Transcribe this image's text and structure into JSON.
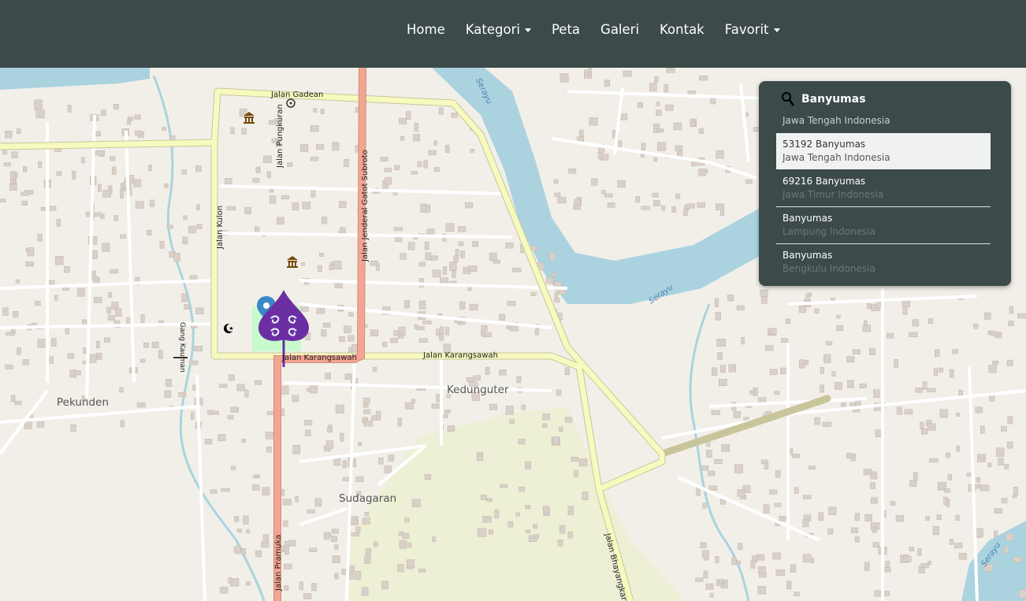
{
  "nav": {
    "items": [
      {
        "label": "Home",
        "dropdown": false
      },
      {
        "label": "Kategori",
        "dropdown": true
      },
      {
        "label": "Peta",
        "dropdown": false
      },
      {
        "label": "Galeri",
        "dropdown": false
      },
      {
        "label": "Kontak",
        "dropdown": false
      },
      {
        "label": "Favorit",
        "dropdown": true
      }
    ]
  },
  "search": {
    "value": "Banyumas",
    "first_result_subtitle": "Jawa Tengah Indonesia",
    "results": [
      {
        "title": "53192 Banyumas",
        "subtitle": "Jawa Tengah Indonesia",
        "active": true
      },
      {
        "title": "69216 Banyumas",
        "subtitle": "Jawa Timur Indonesia",
        "active": false
      },
      {
        "title": "Banyumas",
        "subtitle": "Lampung Indonesia",
        "active": false
      },
      {
        "title": "Banyumas",
        "subtitle": "Bengkulu Indonesia",
        "active": false
      }
    ]
  },
  "map": {
    "labels": {
      "jalan_gadean": "Jalan Gadean",
      "jalan_pungkuran": "Jalan Pungkuran",
      "jalan_gatot_subroto": "Jalan Jenderal Gatot Subroto",
      "jalan_kulon": "Jalan Kulon",
      "gang_kauman": "Gang Kauman",
      "jalan_karangsawah_1": "Jalan Karangsawah",
      "jalan_karangsawah_2": "Jalan Karangsawah",
      "kedunguter": "Kedunguter",
      "pekunden": "Pekunden",
      "sudagaran": "Sudagaran",
      "jalan_pramuka": "Jalan Pramuka",
      "jalan_bhayangkara": "Jalan Bhayangkara",
      "serayu_1": "Serayu",
      "serayu_2": "Serayu",
      "serayu_3": "Serayu"
    },
    "colors": {
      "background": "#f2efe9",
      "water": "#aad3df",
      "secondary_road": "#f7fabf",
      "primary_road": "#f3a593",
      "road_casing": "#c9c59a",
      "park": "#c8facc",
      "farmland": "#eef0d5"
    }
  }
}
